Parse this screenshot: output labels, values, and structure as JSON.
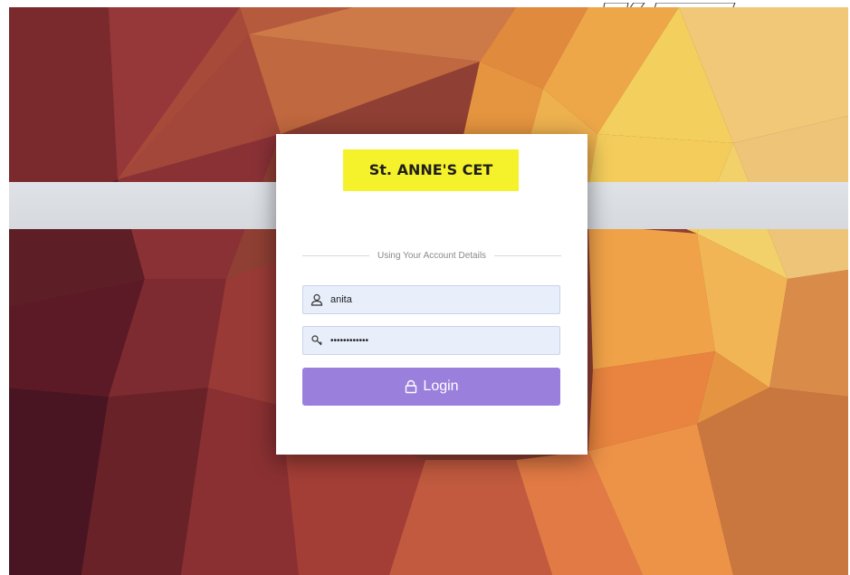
{
  "colors": {
    "accent_button": "#9b7fdc",
    "title_highlight": "#f5f12a",
    "field_background": "#e8eefa",
    "overlay_band": "#dbdee3"
  },
  "login_card": {
    "title": "St. ANNE'S CET",
    "divider_text": "Using Your Account Details",
    "username": {
      "value": "anita",
      "icon": "user-icon"
    },
    "password": {
      "value": "••••••••••••",
      "icon": "key-icon"
    },
    "login_button": {
      "label": "Login",
      "icon": "lock-icon"
    }
  }
}
